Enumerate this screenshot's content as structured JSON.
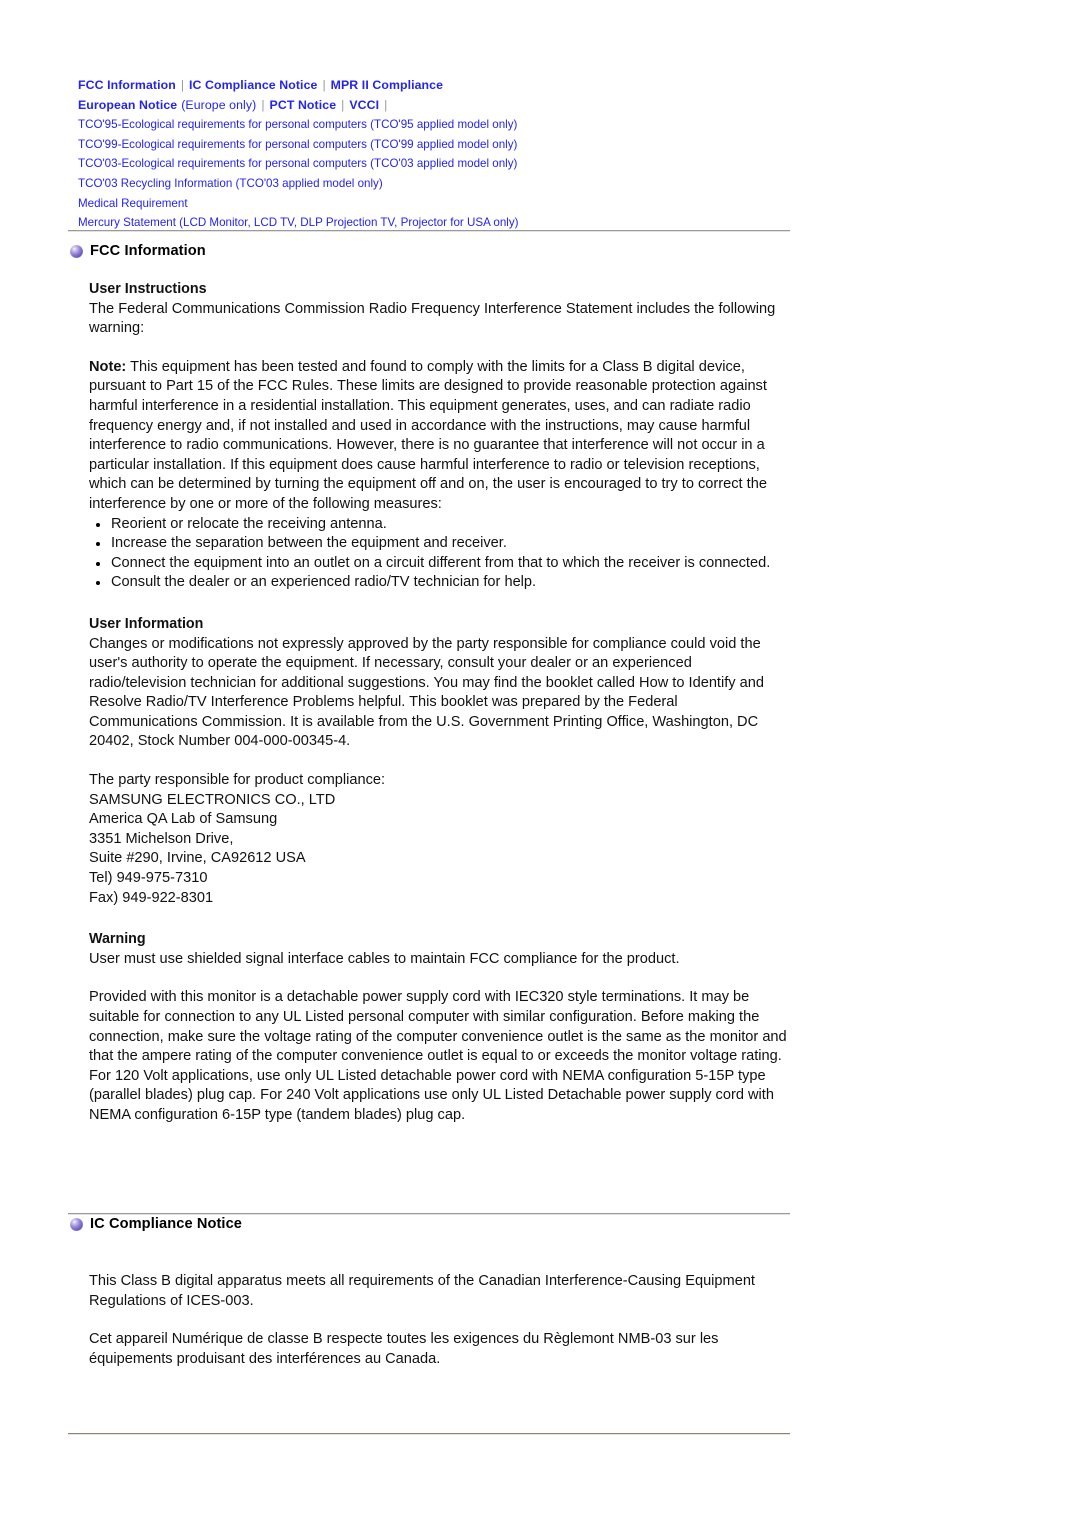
{
  "nav": {
    "row1": [
      {
        "label": "FCC Information",
        "type": "link"
      },
      {
        "label": "|",
        "type": "sep"
      },
      {
        "label": "IC Compliance Notice",
        "type": "link"
      },
      {
        "label": "|",
        "type": "sep"
      },
      {
        "label": "MPR II Compliance",
        "type": "link"
      }
    ],
    "row2": {
      "european_notice": "European Notice",
      "european_suffix": "(Europe only)",
      "sep1": "|",
      "pct_notice": "PCT Notice",
      "sep2": "|",
      "vcci": "VCCI",
      "sep3": "|"
    },
    "rows_small": [
      "TCO'95-Ecological requirements for personal computers (TCO'95 applied model only)",
      "TCO'99-Ecological requirements for personal computers (TCO'99 applied model only)",
      "TCO'03-Ecological requirements for personal computers (TCO'03 applied model only)",
      "TCO'03 Recycling Information (TCO'03 applied model only)",
      "Medical Requirement",
      "Mercury Statement (LCD Monitor, LCD TV, DLP Projection TV, Projector for USA only)"
    ]
  },
  "colors": {
    "link": "#2424ee",
    "separator": "#9a9a9a",
    "orb": "#6a57bd",
    "rule_top": "#9a9a9a",
    "rule_bottom": "#8c8377",
    "text": "#111111"
  },
  "sections": {
    "fcc": {
      "heading": "FCC Information",
      "user_instructions": {
        "subhead": "User Instructions",
        "intro": "The Federal Communications Commission Radio Frequency Interference Statement includes the following warning:",
        "note_label": "Note:",
        "note_body": " This equipment has been tested and found to comply with the limits for a Class B digital device, pursuant to Part 15 of the FCC Rules. These limits are designed to provide reasonable protection against harmful interference in a residential installation. This equipment generates, uses, and can radiate radio frequency energy and, if not installed and used in accordance with the instructions, may cause harmful interference to radio communications. However, there is no guarantee that interference will not occur in a particular installation. If this equipment does cause harmful interference to radio or television receptions, which can be determined by turning the equipment off and on, the user is encouraged to try to correct the interference by one or more of the following measures:",
        "measures": [
          "Reorient or relocate the receiving antenna.",
          "Increase the separation between the equipment and receiver.",
          "Connect the equipment into an outlet on a circuit different from that to which the receiver is connected.",
          "Consult the dealer or an experienced radio/TV technician for help."
        ]
      },
      "user_information": {
        "subhead": "User Information",
        "body": "Changes or modifications not expressly approved by the party responsible for compliance could void the user's authority to operate the equipment. If necessary, consult your dealer or an experienced radio/television technician for additional suggestions. You may find the booklet called How to Identify and Resolve Radio/TV Interference Problems helpful. This booklet was prepared by the Federal Communications Commission. It is available from the U.S. Government Printing Office, Washington, DC 20402, Stock Number 004-000-00345-4.",
        "address": [
          "The party responsible for product compliance:",
          "SAMSUNG ELECTRONICS CO., LTD",
          "America QA Lab of Samsung",
          "3351 Michelson Drive,",
          "Suite #290, Irvine, CA92612 USA",
          "Tel) 949-975-7310",
          "Fax) 949-922-8301"
        ]
      },
      "warning": {
        "subhead": "Warning",
        "line1": "User must use shielded signal interface cables to maintain FCC compliance for the product.",
        "body": "Provided with this monitor is a detachable power supply cord with IEC320 style terminations. It may be suitable for connection to any UL Listed personal computer with similar configuration. Before making the connection, make sure the voltage rating of the computer convenience outlet is the same as the monitor and that the ampere rating of the computer convenience outlet is equal to or exceeds the monitor voltage rating.",
        "body2": "For 120 Volt applications, use only UL Listed detachable power cord with NEMA configuration 5-15P type (parallel blades) plug cap. For 240 Volt applications use only UL Listed Detachable power supply cord with NEMA configuration 6-15P type (tandem blades) plug cap."
      }
    },
    "ic": {
      "heading": "IC Compliance Notice",
      "para1": "This Class B digital apparatus meets all requirements of the Canadian Interference-Causing Equipment Regulations of ICES-003.",
      "para2": "Cet appareil Numérique de classe B respecte toutes les exigences du Règlemont NMB-03 sur les équipements produisant des interférences au Canada."
    }
  }
}
